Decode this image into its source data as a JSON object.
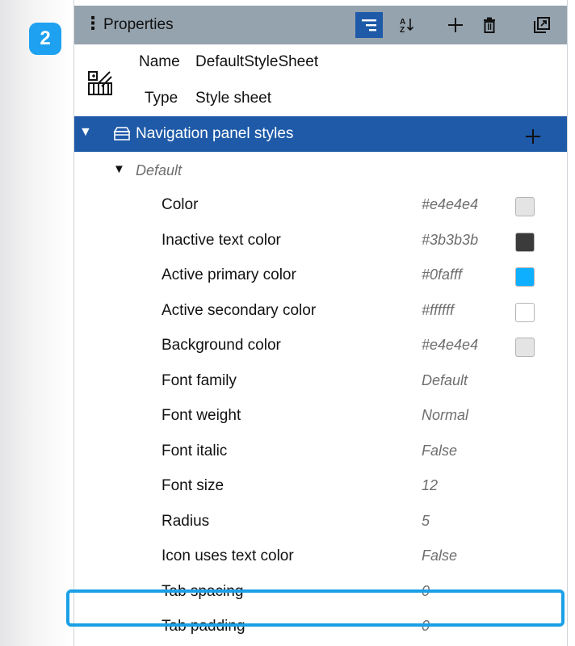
{
  "step_badge": "2",
  "header": {
    "title": "Properties"
  },
  "sheet_info": {
    "name_label": "Name",
    "name_value": "DefaultStyleSheet",
    "type_label": "Type",
    "type_value": "Style sheet"
  },
  "section": {
    "label": "Navigation panel styles"
  },
  "subsection": {
    "label": "Default"
  },
  "properties": [
    {
      "name": "Color",
      "value": "#e4e4e4",
      "swatch": "#e4e4e4"
    },
    {
      "name": "Inactive text color",
      "value": "#3b3b3b",
      "swatch": "#3b3b3b"
    },
    {
      "name": "Active primary color",
      "value": "#0fafff",
      "swatch": "#0fafff"
    },
    {
      "name": "Active secondary color",
      "value": "#ffffff",
      "swatch": "#ffffff"
    },
    {
      "name": "Background color",
      "value": "#e4e4e4",
      "swatch": "#e4e4e4"
    },
    {
      "name": "Font family",
      "value": "Default"
    },
    {
      "name": "Font weight",
      "value": "Normal"
    },
    {
      "name": "Font italic",
      "value": "False"
    },
    {
      "name": "Font size",
      "value": "12"
    },
    {
      "name": "Radius",
      "value": "5"
    },
    {
      "name": "Icon uses text color",
      "value": "False"
    },
    {
      "name": "Tab spacing",
      "value": "0"
    },
    {
      "name": "Tab padding",
      "value": "0"
    }
  ],
  "colors": {
    "header_bg": "#95a3ae",
    "selection_blue": "#1e5aa8",
    "highlight_border": "#1aa0e6",
    "badge_bg": "#1da1f0"
  }
}
